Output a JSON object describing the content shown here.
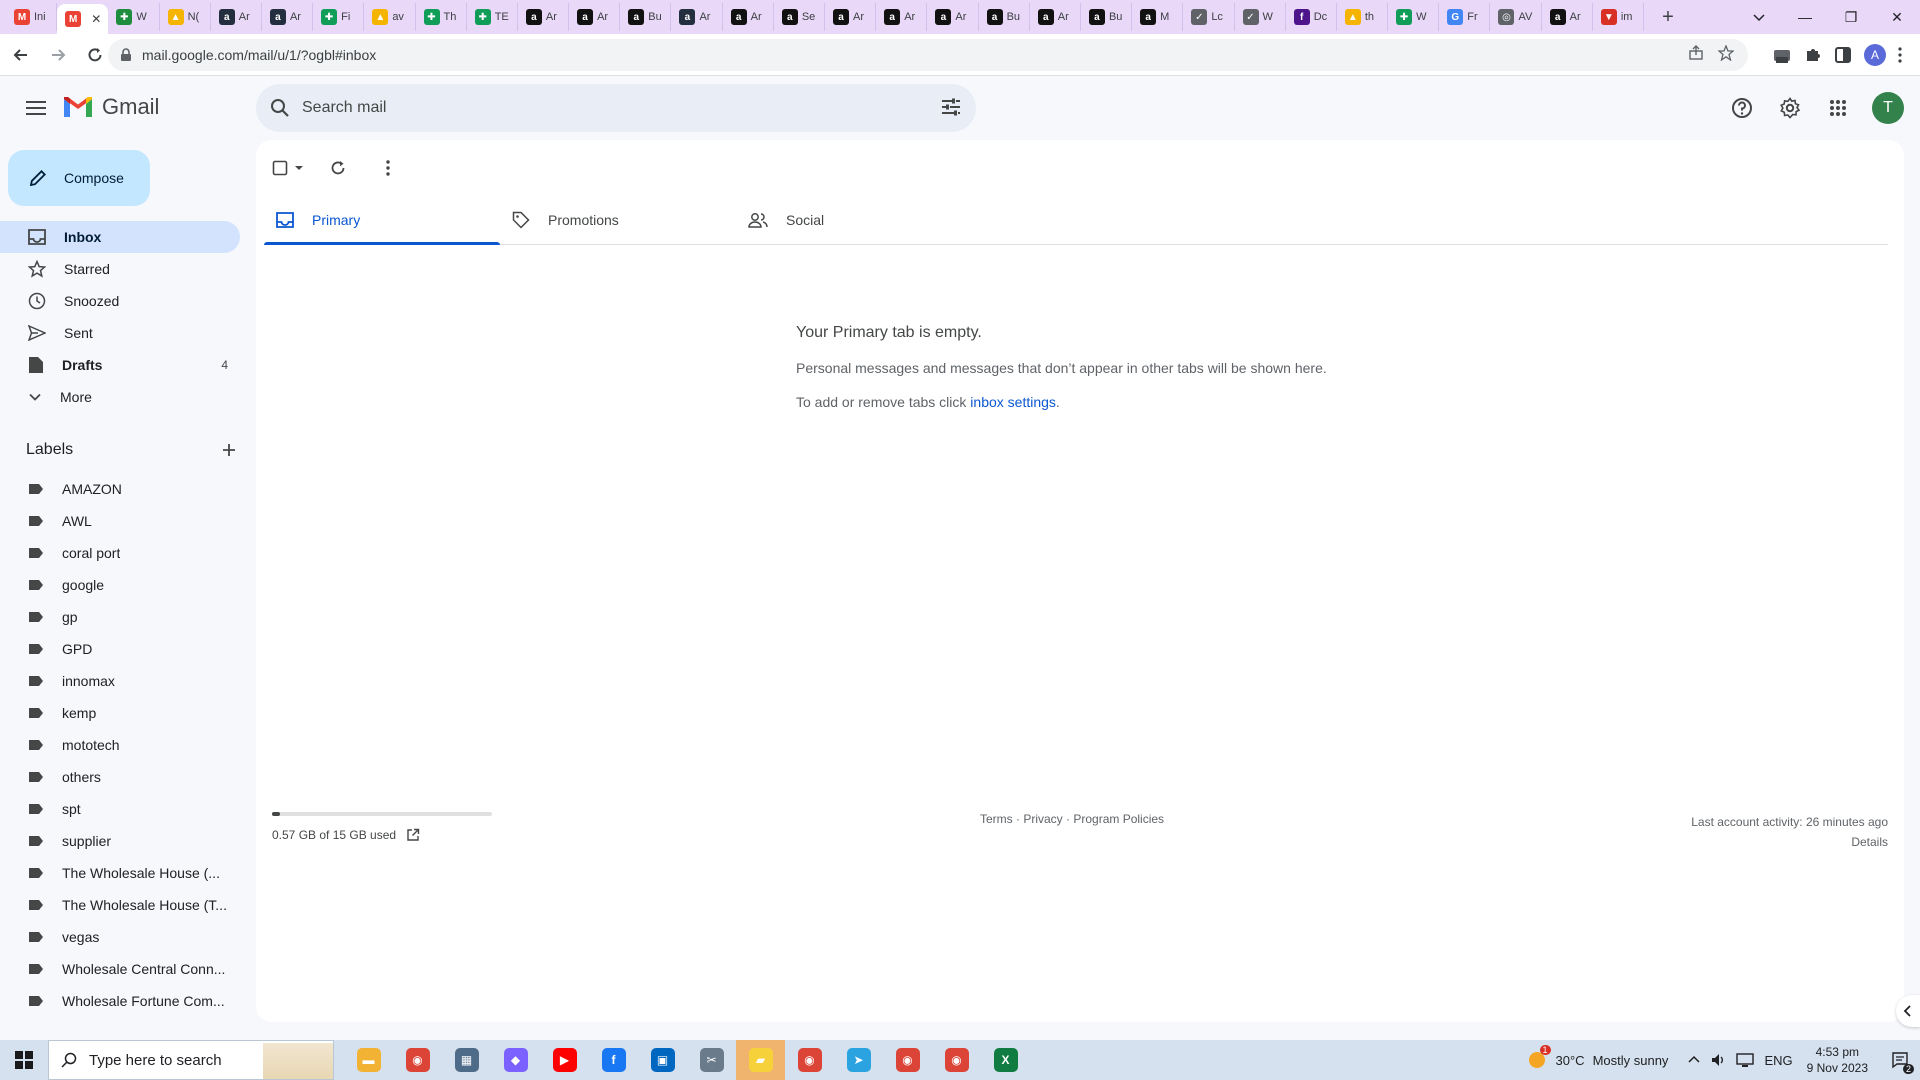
{
  "browser": {
    "tabs": [
      {
        "label": "Ini",
        "favicon": "gmail-favicon",
        "color": "#ea4335",
        "glyph": "M"
      },
      {
        "label": "",
        "favicon": "gmail-favicon",
        "color": "#ea4335",
        "glyph": "M",
        "active": true
      },
      {
        "label": "W",
        "favicon": "puzzle-favicon",
        "color": "#1e8e3e",
        "glyph": "✚"
      },
      {
        "label": "N(",
        "favicon": "drive-favicon",
        "color": "#f4b400",
        "glyph": "▲"
      },
      {
        "label": "Ar",
        "favicon": "amazon-favicon",
        "color": "#232f3e",
        "glyph": "a"
      },
      {
        "label": "Ar",
        "favicon": "amazon-favicon",
        "color": "#232f3e",
        "glyph": "a"
      },
      {
        "label": "Fi",
        "favicon": "sheets-favicon",
        "color": "#0f9d58",
        "glyph": "✚"
      },
      {
        "label": "av",
        "favicon": "drive-favicon",
        "color": "#f4b400",
        "glyph": "▲"
      },
      {
        "label": "Th",
        "favicon": "sheets-favicon",
        "color": "#0f9d58",
        "glyph": "✚"
      },
      {
        "label": "TE",
        "favicon": "sheets-favicon",
        "color": "#0f9d58",
        "glyph": "✚"
      },
      {
        "label": "Ar",
        "favicon": "amazon-favicon",
        "color": "#111111",
        "glyph": "a"
      },
      {
        "label": "Ar",
        "favicon": "amazon-favicon",
        "color": "#111111",
        "glyph": "a"
      },
      {
        "label": "Bu",
        "favicon": "amazon-favicon",
        "color": "#111111",
        "glyph": "a"
      },
      {
        "label": "Ar",
        "favicon": "amazon-favicon",
        "color": "#232f3e",
        "glyph": "a"
      },
      {
        "label": "Ar",
        "favicon": "amazon-favicon",
        "color": "#111111",
        "glyph": "a"
      },
      {
        "label": "Se",
        "favicon": "amazon-favicon",
        "color": "#111111",
        "glyph": "a"
      },
      {
        "label": "Ar",
        "favicon": "amazon-favicon",
        "color": "#111111",
        "glyph": "a"
      },
      {
        "label": "Ar",
        "favicon": "amazon-favicon",
        "color": "#111111",
        "glyph": "a"
      },
      {
        "label": "Ar",
        "favicon": "amazon-favicon",
        "color": "#111111",
        "glyph": "a"
      },
      {
        "label": "Bu",
        "favicon": "amazon-favicon",
        "color": "#111111",
        "glyph": "a"
      },
      {
        "label": "Ar",
        "favicon": "amazon-favicon",
        "color": "#111111",
        "glyph": "a"
      },
      {
        "label": "Bu",
        "favicon": "amazon-favicon",
        "color": "#111111",
        "glyph": "a"
      },
      {
        "label": "M",
        "favicon": "amazon-favicon",
        "color": "#111111",
        "glyph": "a"
      },
      {
        "label": "Lc",
        "favicon": "link-favicon",
        "color": "#5f6368",
        "glyph": "✓"
      },
      {
        "label": "W",
        "favicon": "link-favicon",
        "color": "#5f6368",
        "glyph": "✓"
      },
      {
        "label": "Dc",
        "favicon": "fedex-favicon",
        "color": "#4d148c",
        "glyph": "f"
      },
      {
        "label": "th",
        "favicon": "drive-favicon",
        "color": "#f4b400",
        "glyph": "▲"
      },
      {
        "label": "W",
        "favicon": "sheets-favicon",
        "color": "#0f9d58",
        "glyph": "✚"
      },
      {
        "label": "Fr",
        "favicon": "google-favicon",
        "color": "#4285f4",
        "glyph": "G"
      },
      {
        "label": "AV",
        "favicon": "globe-favicon",
        "color": "#5f6368",
        "glyph": "◎"
      },
      {
        "label": "Ar",
        "favicon": "amazon-favicon",
        "color": "#111111",
        "glyph": "a"
      },
      {
        "label": "im",
        "favicon": "red-favicon",
        "color": "#d93025",
        "glyph": "▼"
      }
    ],
    "url": "mail.google.com/mail/u/1/?ogbl#inbox",
    "profile_initial": "A",
    "accent": "#e9d8f8"
  },
  "gmail": {
    "product_name": "Gmail",
    "search_placeholder": "Search mail",
    "user_initial": "T",
    "compose_label": "Compose",
    "nav": [
      {
        "label": "Inbox",
        "icon": "inbox-icon",
        "active": true
      },
      {
        "label": "Starred",
        "icon": "star-icon"
      },
      {
        "label": "Snoozed",
        "icon": "clock-icon"
      },
      {
        "label": "Sent",
        "icon": "send-icon"
      },
      {
        "label": "Drafts",
        "icon": "draft-icon",
        "count": "4",
        "bold": true
      },
      {
        "label": "More",
        "icon": "chevron-down-icon"
      }
    ],
    "labels_heading": "Labels",
    "labels": [
      "AMAZON",
      "AWL",
      "coral port",
      "google",
      "gp",
      "GPD",
      "innomax",
      "kemp",
      "mototech",
      "others",
      "spt",
      "supplier",
      "The Wholesale House (...",
      "The Wholesale House (T...",
      "vegas",
      "Wholesale Central Conn...",
      "Wholesale Fortune Com..."
    ],
    "category_tabs": [
      {
        "label": "Primary",
        "icon": "inbox-icon",
        "active": true
      },
      {
        "label": "Promotions",
        "icon": "tag-icon"
      },
      {
        "label": "Social",
        "icon": "people-icon"
      }
    ],
    "empty_state": {
      "title": "Your Primary tab is empty.",
      "line1": "Personal messages and messages that don’t appear in other tabs will be shown here.",
      "line2_prefix": "To add or remove tabs click ",
      "line2_link": "inbox settings",
      "line2_suffix": "."
    },
    "footer": {
      "storage_text": "0.57 GB of 15 GB used",
      "storage_fraction": 0.038,
      "terms": "Terms",
      "privacy": "Privacy",
      "policies": "Program Policies",
      "separator": " · ",
      "last_activity": "Last account activity: 26 minutes ago",
      "details": "Details"
    },
    "accent": "#0b57d0"
  },
  "taskbar": {
    "search_placeholder": "Type here to search",
    "apps": [
      {
        "name": "file-explorer-icon",
        "color": "#f2b233",
        "glyph": "▬"
      },
      {
        "name": "chrome-icon",
        "color": "#db4437",
        "glyph": "◉"
      },
      {
        "name": "calculator-icon",
        "color": "#4f6b8a",
        "glyph": "▦"
      },
      {
        "name": "copilot-icon",
        "color": "#7b61ff",
        "glyph": "◆"
      },
      {
        "name": "youtube-icon",
        "color": "#ff0000",
        "glyph": "▶"
      },
      {
        "name": "facebook-icon",
        "color": "#1877f2",
        "glyph": "f"
      },
      {
        "name": "store-icon",
        "color": "#0067c0",
        "glyph": "▣"
      },
      {
        "name": "snipping-tool-icon",
        "color": "#6a7b8c",
        "glyph": "✂"
      },
      {
        "name": "sticky-notes-icon",
        "color": "#f7d13a",
        "glyph": "▰",
        "active": true
      },
      {
        "name": "chrome-profile-icon",
        "color": "#db4437",
        "glyph": "◉"
      },
      {
        "name": "telegram-icon",
        "color": "#2aa3e0",
        "glyph": "➤"
      },
      {
        "name": "chrome-profile-a-icon",
        "color": "#db4437",
        "glyph": "◉"
      },
      {
        "name": "chrome-profile-c-icon",
        "color": "#db4437",
        "glyph": "◉"
      },
      {
        "name": "excel-icon",
        "color": "#107c41",
        "glyph": "X"
      }
    ],
    "weather_temp": "30°C",
    "weather_desc": "Mostly sunny",
    "weather_badge": "1",
    "language": "ENG",
    "time": "4:53 pm",
    "date": "9 Nov 2023",
    "notification_count": "2"
  }
}
